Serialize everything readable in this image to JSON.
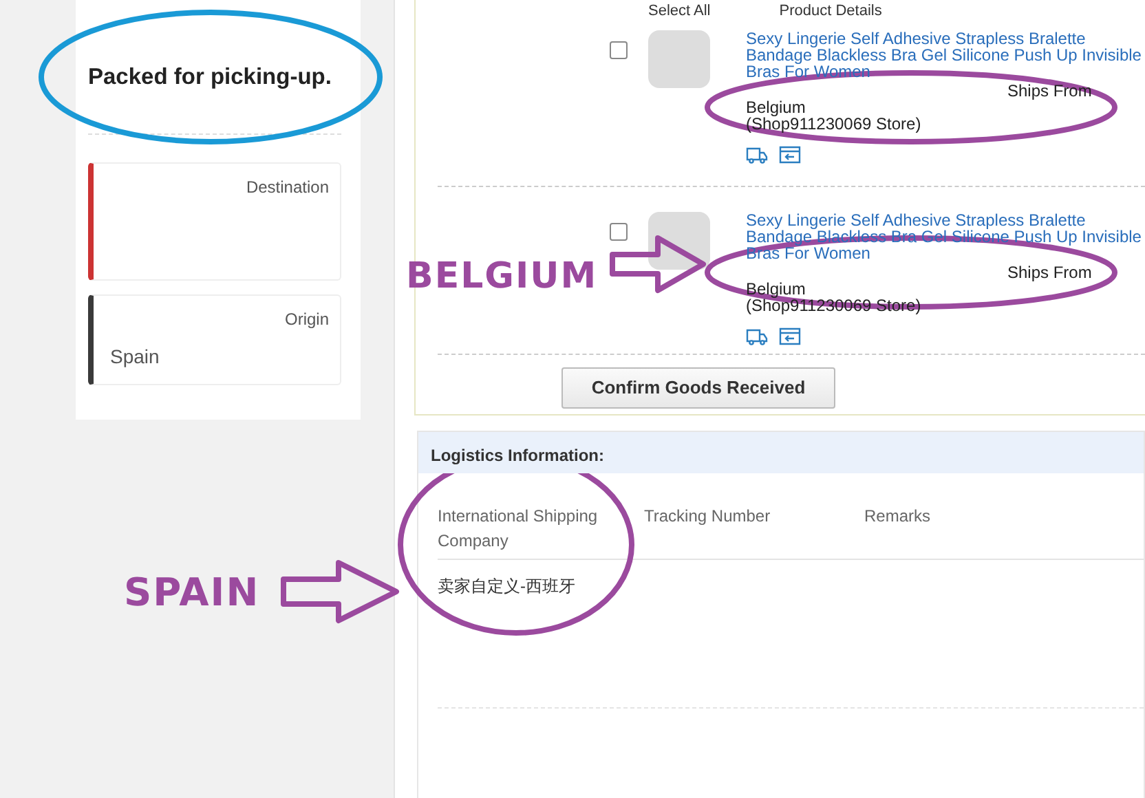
{
  "status_card": {
    "title": "Packed for picking-up.",
    "destination": {
      "label": "Destination"
    },
    "origin": {
      "label": "Origin",
      "value": "Spain"
    }
  },
  "products": {
    "header": {
      "select_all": "Select All",
      "product_details": "Product Details"
    },
    "items": [
      {
        "checked": false,
        "title": "Sexy Lingerie Self Adhesive Strapless Bralette Bandage Blackless Bra Gel Silicone Push Up Invisible Bras For Women",
        "ships_from": "Ships From",
        "country": "Belgium",
        "store": "(Shop911230069 Store)"
      },
      {
        "checked": false,
        "title": "Sexy Lingerie Self Adhesive Strapless Bralette Bandage Blackless Bra Gel Silicone Push Up Invisible Bras For Women",
        "ships_from": "Ships From",
        "country": "Belgium",
        "store": "(Shop911230069 Store)"
      }
    ],
    "confirm_button": "Confirm Goods Received"
  },
  "logistics": {
    "title": "Logistics Information:",
    "columns": [
      "International Shipping Company",
      "Tracking Number",
      "Remarks"
    ],
    "rows": [
      [
        "卖家自定义-西班牙"
      ]
    ]
  },
  "annotations": [
    "BELGIUM",
    "SPAIN"
  ]
}
